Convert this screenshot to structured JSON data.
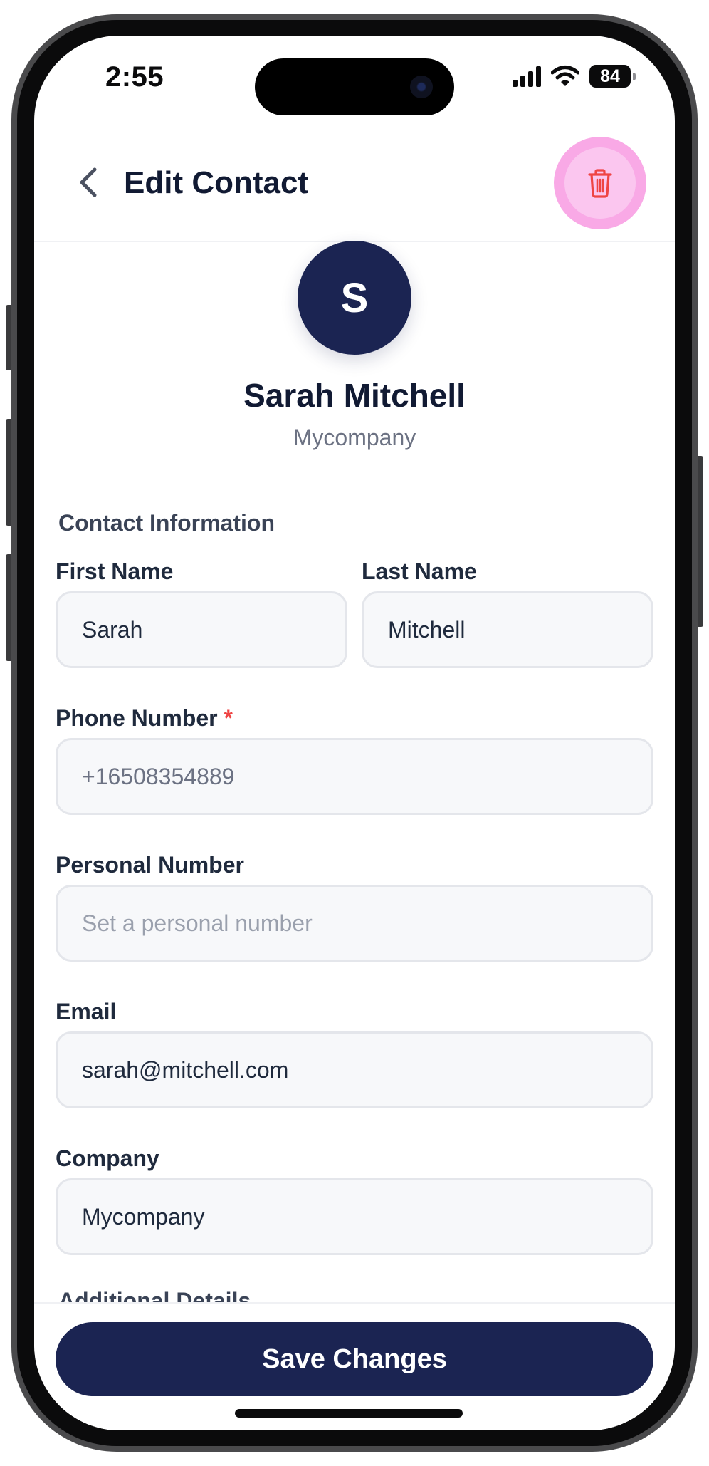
{
  "status_bar": {
    "time": "2:55",
    "battery": "84"
  },
  "header": {
    "title": "Edit Contact",
    "back_icon": "chevron-left-icon",
    "delete_icon": "trash-icon"
  },
  "profile": {
    "avatar_initial": "S",
    "name": "Sarah Mitchell",
    "company": "Mycompany"
  },
  "form": {
    "section_title": "Contact Information",
    "first_name": {
      "label": "First Name",
      "value": "Sarah"
    },
    "last_name": {
      "label": "Last Name",
      "value": "Mitchell"
    },
    "phone": {
      "label": "Phone Number",
      "required_mark": "*",
      "value": "+16508354889"
    },
    "personal_number": {
      "label": "Personal Number",
      "placeholder": "Set a personal number"
    },
    "email": {
      "label": "Email",
      "value": "sarah@mitchell.com"
    },
    "company": {
      "label": "Company",
      "value": "Mycompany"
    },
    "additional_section_title": "Additional Details"
  },
  "footer": {
    "save_label": "Save Changes"
  },
  "colors": {
    "primary": "#1b2452",
    "danger": "#ef4444",
    "delete_highlight": "#f9a9e6",
    "input_background": "#f7f8fa"
  }
}
